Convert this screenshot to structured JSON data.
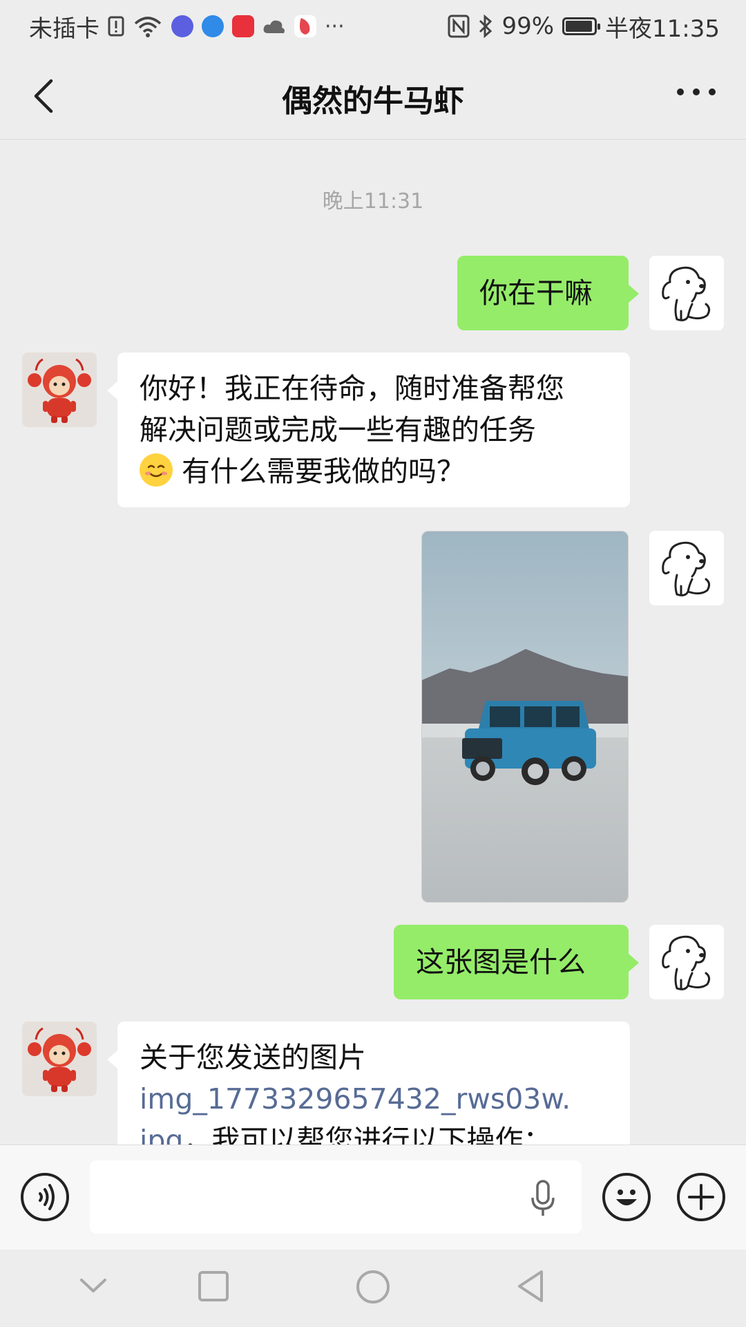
{
  "status_bar": {
    "carrier": "未插卡",
    "app_icon_colors": [
      "#5b5fe0",
      "#2f8ae8",
      "#e8313c",
      "#666666",
      "#e5464f"
    ],
    "more": "···",
    "battery": "99%",
    "battery_level": 0.99,
    "time": "半夜11:35"
  },
  "header": {
    "title": "偶然的牛马虾"
  },
  "chat": {
    "timestamp": "晚上11:31",
    "messages": [
      {
        "from": "me",
        "type": "text",
        "text": "你在干嘛"
      },
      {
        "from": "bot",
        "type": "text",
        "lines": [
          "你好！我正在待命，随时准备帮您",
          "解决问题或完成一些有趣的任务",
          "有什么需要我做的吗？"
        ]
      },
      {
        "from": "me",
        "type": "image",
        "description_icon": "photo"
      },
      {
        "from": "me",
        "type": "text",
        "text": "这张图是什么"
      },
      {
        "from": "bot",
        "type": "text",
        "line1": "关于您发送的图片",
        "link1": "img_1773329657432_rws03w.",
        "link2": "jpg",
        "line3": "，我可以帮您进行以下操作："
      }
    ]
  },
  "input": {
    "placeholder": ""
  },
  "colors": {
    "my_bubble": "#95ec69",
    "link": "#576b95"
  }
}
